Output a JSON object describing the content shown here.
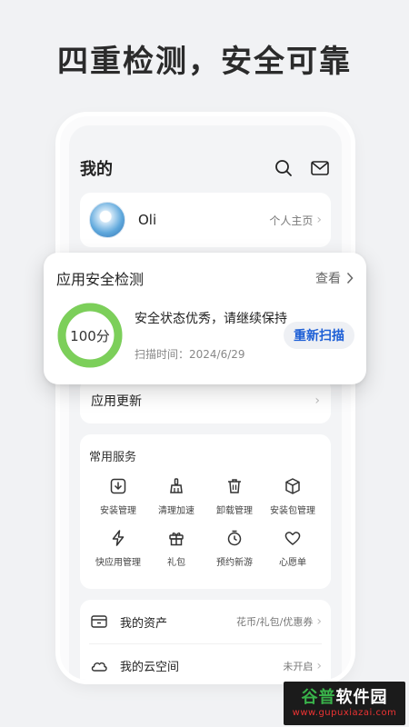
{
  "headline": "四重检测，安全可靠",
  "header": {
    "title": "我的",
    "search_icon": "search-icon",
    "mail_icon": "mail-icon"
  },
  "profile": {
    "name": "Oli",
    "link": "个人主页"
  },
  "security": {
    "title": "应用安全检测",
    "more": "查看",
    "score": "100分",
    "score_fraction": 1.0,
    "ring_color": "#7ccf5a",
    "message": "安全状态优秀，请继续保持",
    "scan_time": "扫描时间：2024/6/29",
    "rescan": "重新扫描"
  },
  "update": {
    "label": "应用更新"
  },
  "services": {
    "title": "常用服务",
    "items": [
      {
        "label": "安装管理",
        "icon": "install-icon"
      },
      {
        "label": "清理加速",
        "icon": "broom-icon"
      },
      {
        "label": "卸载管理",
        "icon": "trash-icon"
      },
      {
        "label": "安装包管理",
        "icon": "package-icon"
      },
      {
        "label": "快应用管理",
        "icon": "bolt-icon"
      },
      {
        "label": "礼包",
        "icon": "gift-icon"
      },
      {
        "label": "预约新游",
        "icon": "timer-icon"
      },
      {
        "label": "心愿单",
        "icon": "heart-icon"
      }
    ]
  },
  "assets": [
    {
      "label": "我的资产",
      "value": "花币/礼包/优惠券",
      "icon": "wallet-icon"
    },
    {
      "label": "我的云空间",
      "value": "未开启",
      "icon": "cloud-icon"
    }
  ],
  "watermark": {
    "line1a": "谷普",
    "line1b": "软件园",
    "line2": "www.gupuxiazai.com"
  },
  "colors": {
    "accent": "#1d5fd6",
    "ring": "#7ccf5a",
    "background": "#f1f2f4"
  }
}
